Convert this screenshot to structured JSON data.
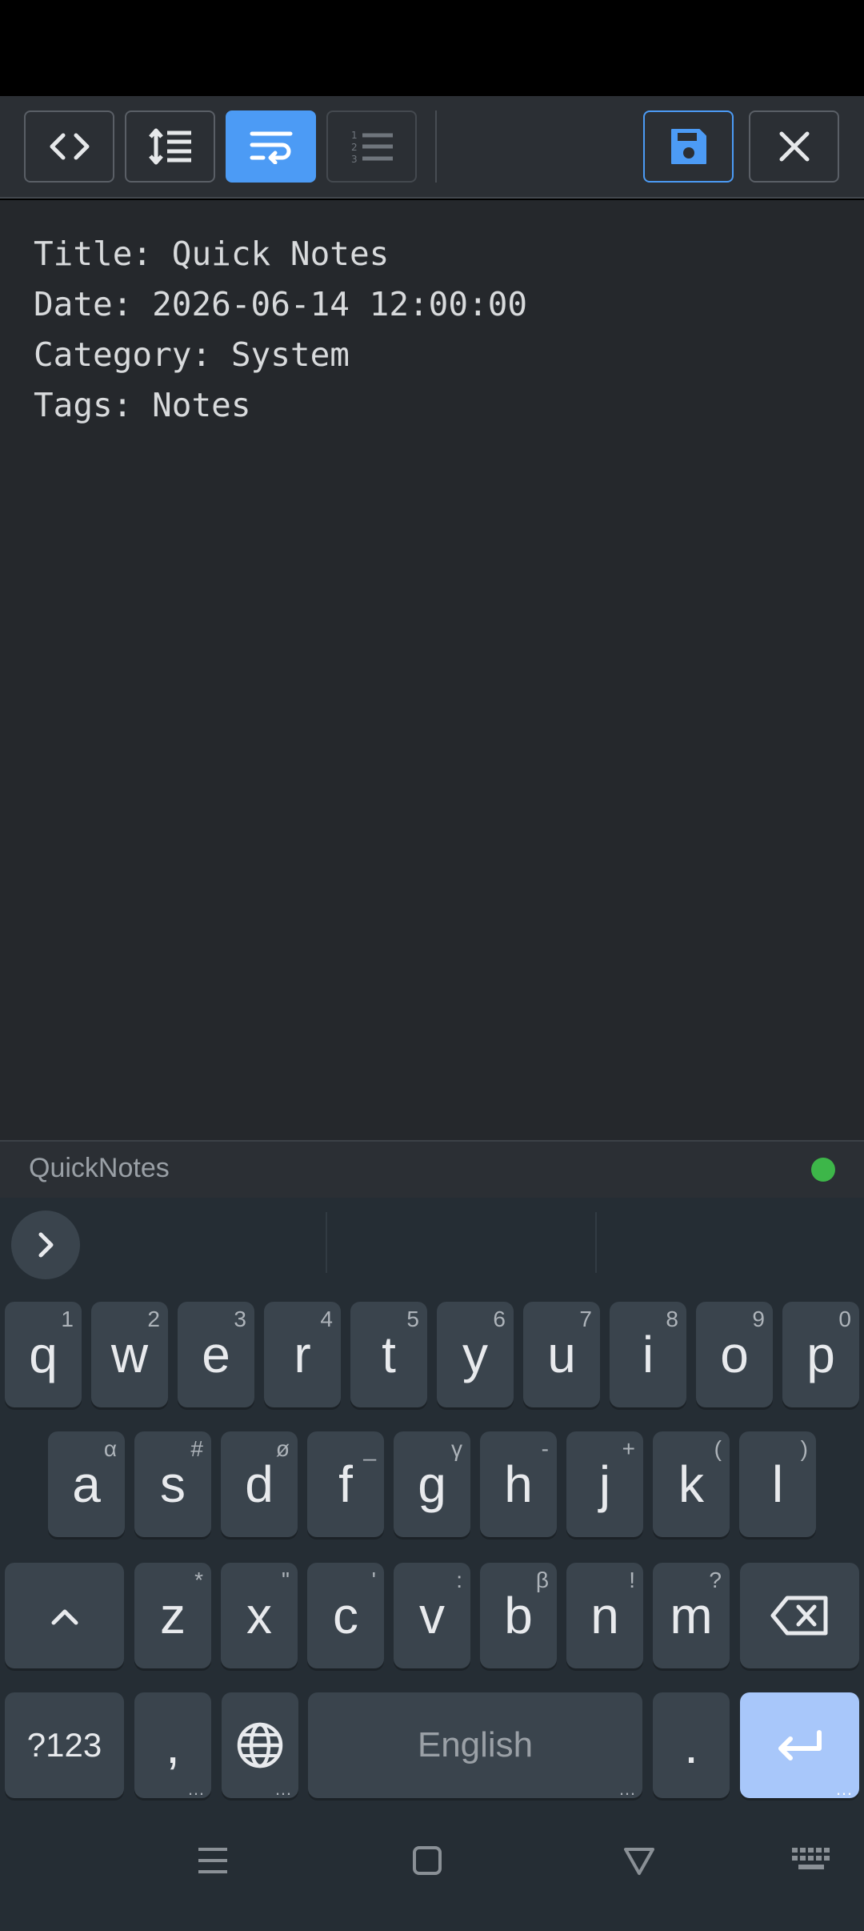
{
  "editor": {
    "lines": [
      "Title: Quick Notes",
      "Date: 2026-06-14 12:00:00",
      "Category: System",
      "Tags: Notes"
    ]
  },
  "footer": {
    "app_name": "QuickNotes",
    "status_color": "#3db649"
  },
  "colors": {
    "accent": "#4c9bf5",
    "enter_key": "#a8c7fa"
  },
  "toolbar": {
    "buttons": [
      {
        "name": "code-view-icon",
        "state": "normal"
      },
      {
        "name": "line-height-icon",
        "state": "normal"
      },
      {
        "name": "word-wrap-icon",
        "state": "active"
      },
      {
        "name": "line-numbers-icon",
        "state": "disabled"
      },
      {
        "name": "save-icon",
        "state": "highlight"
      },
      {
        "name": "close-icon",
        "state": "normal"
      }
    ]
  },
  "keyboard": {
    "row1": [
      {
        "k": "q",
        "h": "1"
      },
      {
        "k": "w",
        "h": "2"
      },
      {
        "k": "e",
        "h": "3"
      },
      {
        "k": "r",
        "h": "4"
      },
      {
        "k": "t",
        "h": "5"
      },
      {
        "k": "y",
        "h": "6"
      },
      {
        "k": "u",
        "h": "7"
      },
      {
        "k": "i",
        "h": "8"
      },
      {
        "k": "o",
        "h": "9"
      },
      {
        "k": "p",
        "h": "0"
      }
    ],
    "row2": [
      {
        "k": "a",
        "h": "α"
      },
      {
        "k": "s",
        "h": "#"
      },
      {
        "k": "d",
        "h": "ø"
      },
      {
        "k": "f",
        "h": "_"
      },
      {
        "k": "g",
        "h": "γ"
      },
      {
        "k": "h",
        "h": "-"
      },
      {
        "k": "j",
        "h": "+"
      },
      {
        "k": "k",
        "h": "("
      },
      {
        "k": "l",
        "h": ")"
      }
    ],
    "row3": [
      {
        "k": "z",
        "h": "*"
      },
      {
        "k": "x",
        "h": "\""
      },
      {
        "k": "c",
        "h": "'"
      },
      {
        "k": "v",
        "h": ":"
      },
      {
        "k": "b",
        "h": "β"
      },
      {
        "k": "n",
        "h": "!"
      },
      {
        "k": "m",
        "h": "?"
      }
    ],
    "symbols_label": "?123",
    "comma_label": ",",
    "space_label": "English",
    "period_label": ".",
    "more_dots": "…"
  }
}
